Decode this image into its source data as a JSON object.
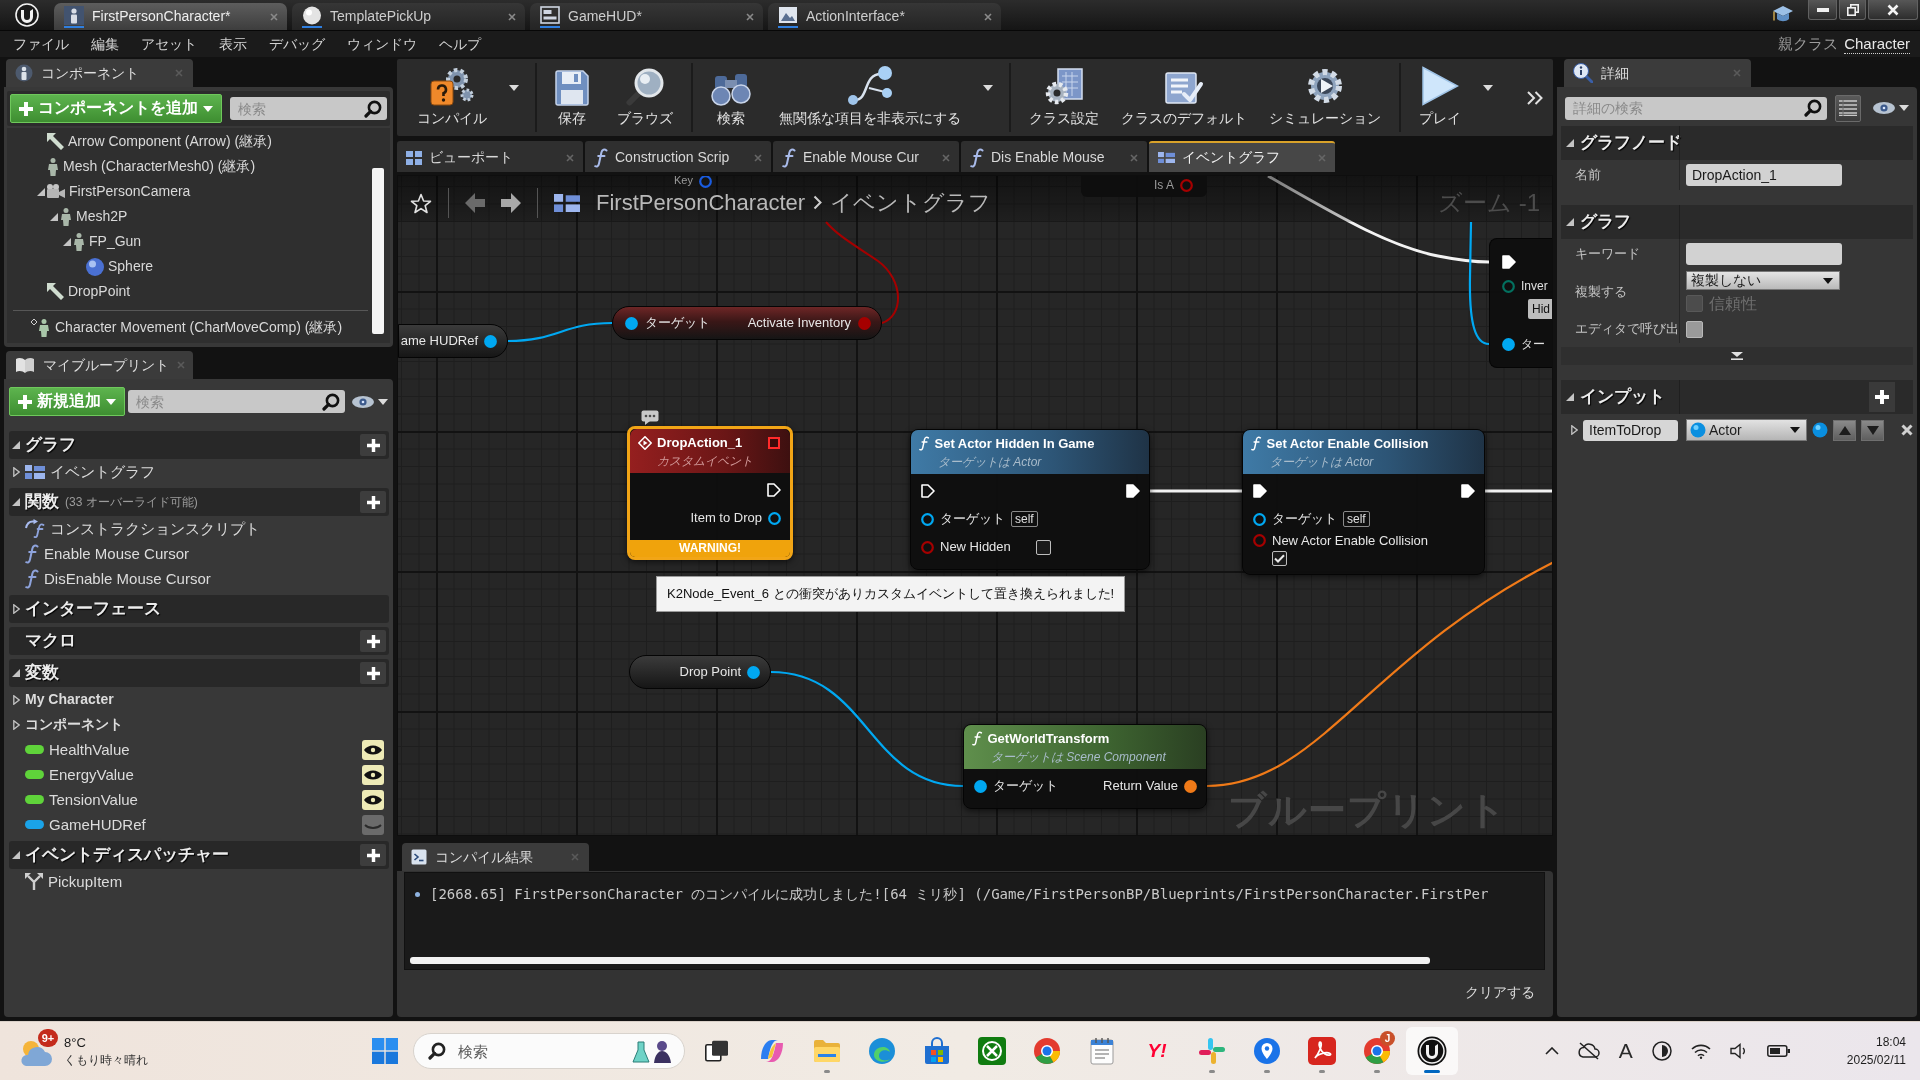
{
  "title_bar": {
    "tabs": [
      {
        "label": "FirstPersonCharacter*",
        "kind": "blueprint",
        "selected": true
      },
      {
        "label": "TemplatePickUp",
        "kind": "material",
        "selected": false
      },
      {
        "label": "GameHUD*",
        "kind": "widget",
        "selected": false
      },
      {
        "label": "ActionInterface*",
        "kind": "interface",
        "selected": false
      }
    ]
  },
  "menu_bar": {
    "items": [
      "ファイル",
      "編集",
      "アセット",
      "表示",
      "デバッグ",
      "ウィンドウ",
      "ヘルプ"
    ],
    "parent_class_label": "親クラス",
    "parent_class": "Character"
  },
  "components": {
    "tab": "コンポーネント",
    "add_button": "コンポーネントを追加",
    "search": {
      "placeholder": "検索"
    },
    "tree": [
      {
        "label": "Arrow Component (Arrow) (継承)",
        "kind": "arrow"
      },
      {
        "label": "Mesh (CharacterMesh0) (継承)",
        "kind": "mesh"
      },
      {
        "label": "FirstPersonCamera",
        "kind": "camera",
        "expanded": true,
        "children": [
          {
            "label": "Mesh2P",
            "kind": "mesh",
            "expanded": true,
            "children": [
              {
                "label": "FP_Gun",
                "kind": "mesh",
                "expanded": true,
                "children": [
                  {
                    "label": "Sphere",
                    "kind": "sphere"
                  }
                ]
              }
            ]
          }
        ]
      },
      {
        "label": "DropPoint",
        "kind": "arrow"
      }
    ],
    "movement": {
      "label": "Character Movement (CharMoveComp) (継承)",
      "kind": "movement"
    }
  },
  "my_blueprint": {
    "tab": "マイブループリント",
    "add_button": "新規追加",
    "search": {
      "placeholder": "検索"
    },
    "sections": [
      {
        "title": "グラフ",
        "expanded": true,
        "add_button": true,
        "items": [
          {
            "label": "イベントグラフ",
            "kind": "graph",
            "expanded": false
          }
        ]
      },
      {
        "title": "関数",
        "note": "(33 オーバーライド可能)",
        "expanded": true,
        "add_button": true,
        "items": [
          {
            "label": "コンストラクションスクリプト",
            "kind": "construction"
          },
          {
            "label": "Enable Mouse Cursor",
            "kind": "function"
          },
          {
            "label": "DisEnable Mouse Cursor",
            "kind": "function"
          }
        ]
      },
      {
        "title": "インターフェース",
        "expanded": false,
        "add_button": false
      },
      {
        "title": "マクロ",
        "add_button": true
      },
      {
        "title": "変数",
        "expanded": true,
        "add_button": true,
        "items": [
          {
            "label": "My Character",
            "kind": "category",
            "expanded": false
          },
          {
            "label": "コンポーネント",
            "kind": "category",
            "expanded": false
          },
          {
            "label": "HealthValue",
            "kind": "variable",
            "color": "#5fd33a",
            "visible": true
          },
          {
            "label": "EnergyValue",
            "kind": "variable",
            "color": "#5fd33a",
            "visible": true
          },
          {
            "label": "TensionValue",
            "kind": "variable",
            "color": "#5fd33a",
            "visible": true
          },
          {
            "label": "GameHUDRef",
            "kind": "variable",
            "color": "#1aa3e8",
            "visible": false
          }
        ]
      },
      {
        "title": "イベントディスパッチャー",
        "expanded": true,
        "add_button": true,
        "items": [
          {
            "label": "PickupItem",
            "kind": "dispatcher"
          }
        ]
      }
    ]
  },
  "toolbar": {
    "groups": [
      [
        {
          "label": "コンパイル",
          "kind": "compile",
          "dropdown": true
        }
      ],
      [
        {
          "label": "保存",
          "kind": "save",
          "dropdown": false
        },
        {
          "label": "ブラウズ",
          "kind": "browse",
          "dropdown": false
        }
      ],
      [
        {
          "label": "検索",
          "kind": "find",
          "dropdown": false
        },
        {
          "label": "無関係な項目を非表示にする",
          "kind": "hide",
          "dropdown": true
        }
      ],
      [
        {
          "label": "クラス設定",
          "kind": "class_settings",
          "dropdown": false
        },
        {
          "label": "クラスのデフォルト",
          "kind": "class_defaults",
          "dropdown": false
        },
        {
          "label": "シミュレーション",
          "kind": "simulation",
          "dropdown": false
        }
      ],
      [
        {
          "label": "プレイ",
          "kind": "play",
          "dropdown": true
        }
      ]
    ]
  },
  "graph_tabs": [
    {
      "label": "ビューポート",
      "kind": "viewport",
      "selected": false
    },
    {
      "label": "Construction Scrip",
      "kind": "function",
      "selected": false
    },
    {
      "label": "Enable Mouse Cur",
      "kind": "function",
      "selected": false
    },
    {
      "label": "Dis Enable Mouse",
      "kind": "function",
      "selected": false
    },
    {
      "label": "イベントグラフ",
      "kind": "graph",
      "selected": true
    }
  ],
  "graph": {
    "breadcrumb": [
      "FirstPersonCharacter",
      "イベントグラフ"
    ],
    "zoom": "ズーム -1",
    "watermark": "ブループリント",
    "nodes": [
      {
        "kind": "fragment",
        "boxed": false,
        "pins": [
          {
            "label": "Key",
            "kind": "struct",
            "connected": false
          }
        ]
      },
      {
        "kind": "fragment",
        "boxed": true,
        "pins": [
          {
            "label": "Is A",
            "kind": "bool",
            "connected": false
          }
        ]
      },
      {
        "kind": "variable",
        "label": "ame HUDRef",
        "pin": {
          "kind": "object",
          "connected": true
        }
      },
      {
        "kind": "compact",
        "inputs": [
          {
            "label": "ターゲット",
            "kind": "object",
            "connected": true
          }
        ],
        "outputs": [
          {
            "label": "Activate Inventory",
            "kind": "bool",
            "connected": true
          }
        ]
      },
      {
        "kind": "event",
        "title": "DropAction_1",
        "subtitle": "カスタムイベント",
        "selected": true,
        "comment": true,
        "warning": "WARNING!",
        "tooltip": "K2Node_Event_6 との衝突がありカスタムイベントして置き換えられました!",
        "outputs": [
          {
            "kind": "exec",
            "connected": false
          },
          {
            "label": "Item to Drop",
            "kind": "object",
            "connected": false
          }
        ]
      },
      {
        "kind": "function",
        "pure": false,
        "title": "Set Actor Hidden In Game",
        "subtitle": "ターゲットは Actor",
        "inputs": [
          {
            "kind": "exec",
            "connected": false
          },
          {
            "label": "ターゲット",
            "kind": "object",
            "connected": false,
            "default": "self"
          },
          {
            "label": "New Hidden",
            "kind": "bool",
            "connected": false,
            "checked": false
          }
        ],
        "outputs": [
          {
            "kind": "exec",
            "connected": true
          }
        ]
      },
      {
        "kind": "function",
        "pure": false,
        "title": "Set Actor Enable Collision",
        "subtitle": "ターゲットは Actor",
        "inputs": [
          {
            "kind": "exec",
            "connected": true
          },
          {
            "label": "ターゲット",
            "kind": "object",
            "connected": false,
            "default": "self"
          },
          {
            "label": "New Actor Enable Collision",
            "kind": "bool",
            "connected": false,
            "checked": true
          }
        ],
        "outputs": [
          {
            "kind": "exec",
            "connected": true
          }
        ]
      },
      {
        "kind": "variable",
        "label": "Drop Point",
        "pin": {
          "kind": "object",
          "connected": true
        }
      },
      {
        "kind": "function",
        "pure": true,
        "title": "GetWorldTransform",
        "subtitle": "ターゲットは Scene Component",
        "inputs": [
          {
            "label": "ターゲット",
            "kind": "object",
            "connected": true
          }
        ],
        "outputs": [
          {
            "label": "Return Value",
            "kind": "transform",
            "connected": true
          }
        ]
      },
      {
        "kind": "fragment_node",
        "inputs": [
          {
            "kind": "exec",
            "connected": true
          },
          {
            "label": "Inver",
            "kind": "byte",
            "connected": false,
            "default": "Hid"
          },
          {
            "label": "ター",
            "kind": "object",
            "connected": true
          }
        ]
      }
    ]
  },
  "compile_results": {
    "tab": "コンパイル結果",
    "messages": [
      "[2668.65] FirstPersonCharacter のコンパイルに成功しました![64 ミリ秒] (/Game/FirstPersonBP/Blueprints/FirstPersonCharacter.FirstPer"
    ],
    "clear_button": "クリアする"
  },
  "details": {
    "tab": "詳細",
    "search": {
      "placeholder": "詳細の検索"
    },
    "sections": [
      {
        "title": "グラフノード",
        "expanded": true,
        "rows": [
          {
            "kind": "text",
            "label": "名前",
            "value": "DropAction_1"
          }
        ]
      },
      {
        "title": "グラフ",
        "expanded": true,
        "advanced_expanded": false,
        "rows": [
          {
            "kind": "text",
            "label": "キーワード"
          },
          {
            "kind": "select",
            "label": "複製する",
            "value": "複製しない",
            "option": {
              "label": "信頼性",
              "checked": false,
              "disabled": true
            }
          },
          {
            "kind": "checkbox",
            "label": "エディタで呼び出",
            "checked": false
          }
        ]
      },
      {
        "title": "インプット",
        "expanded": true,
        "add_button": true,
        "inputs": [
          {
            "name": "ItemToDrop",
            "type": "Actor",
            "kind": "object",
            "expanded": false
          }
        ]
      }
    ]
  },
  "taskbar": {
    "weather": {
      "temperature": "8°C",
      "condition": "くもり時々晴れ",
      "badge": "9+"
    },
    "search": {
      "placeholder": "検索"
    },
    "apps": [
      {
        "kind": "task_view",
        "running": false,
        "selected": false
      },
      {
        "kind": "copilot",
        "running": false,
        "selected": false
      },
      {
        "kind": "explorer",
        "running": true,
        "selected": false
      },
      {
        "kind": "edge",
        "running": false,
        "selected": false
      },
      {
        "kind": "store",
        "running": false,
        "selected": false
      },
      {
        "kind": "xbox",
        "running": false,
        "selected": false
      },
      {
        "kind": "chrome",
        "running": false,
        "selected": false
      },
      {
        "kind": "notepad",
        "running": false,
        "selected": false
      },
      {
        "kind": "yahoo",
        "label": "Y!",
        "running": false,
        "selected": false
      },
      {
        "kind": "slack",
        "running": true,
        "selected": false
      },
      {
        "kind": "maps",
        "running": true,
        "selected": false
      },
      {
        "kind": "acrobat",
        "running": true,
        "selected": false
      },
      {
        "kind": "chrome",
        "badge": "J",
        "running": true,
        "selected": false
      },
      {
        "kind": "unreal",
        "running": true,
        "selected": true
      }
    ],
    "tray": [
      {
        "kind": "chevron"
      },
      {
        "kind": "cloud_off"
      },
      {
        "kind": "ime",
        "label": "A"
      },
      {
        "kind": "focus"
      },
      {
        "kind": "wifi"
      },
      {
        "kind": "volume"
      },
      {
        "kind": "battery"
      }
    ],
    "time": "18:04",
    "date": "2025/02/11"
  }
}
